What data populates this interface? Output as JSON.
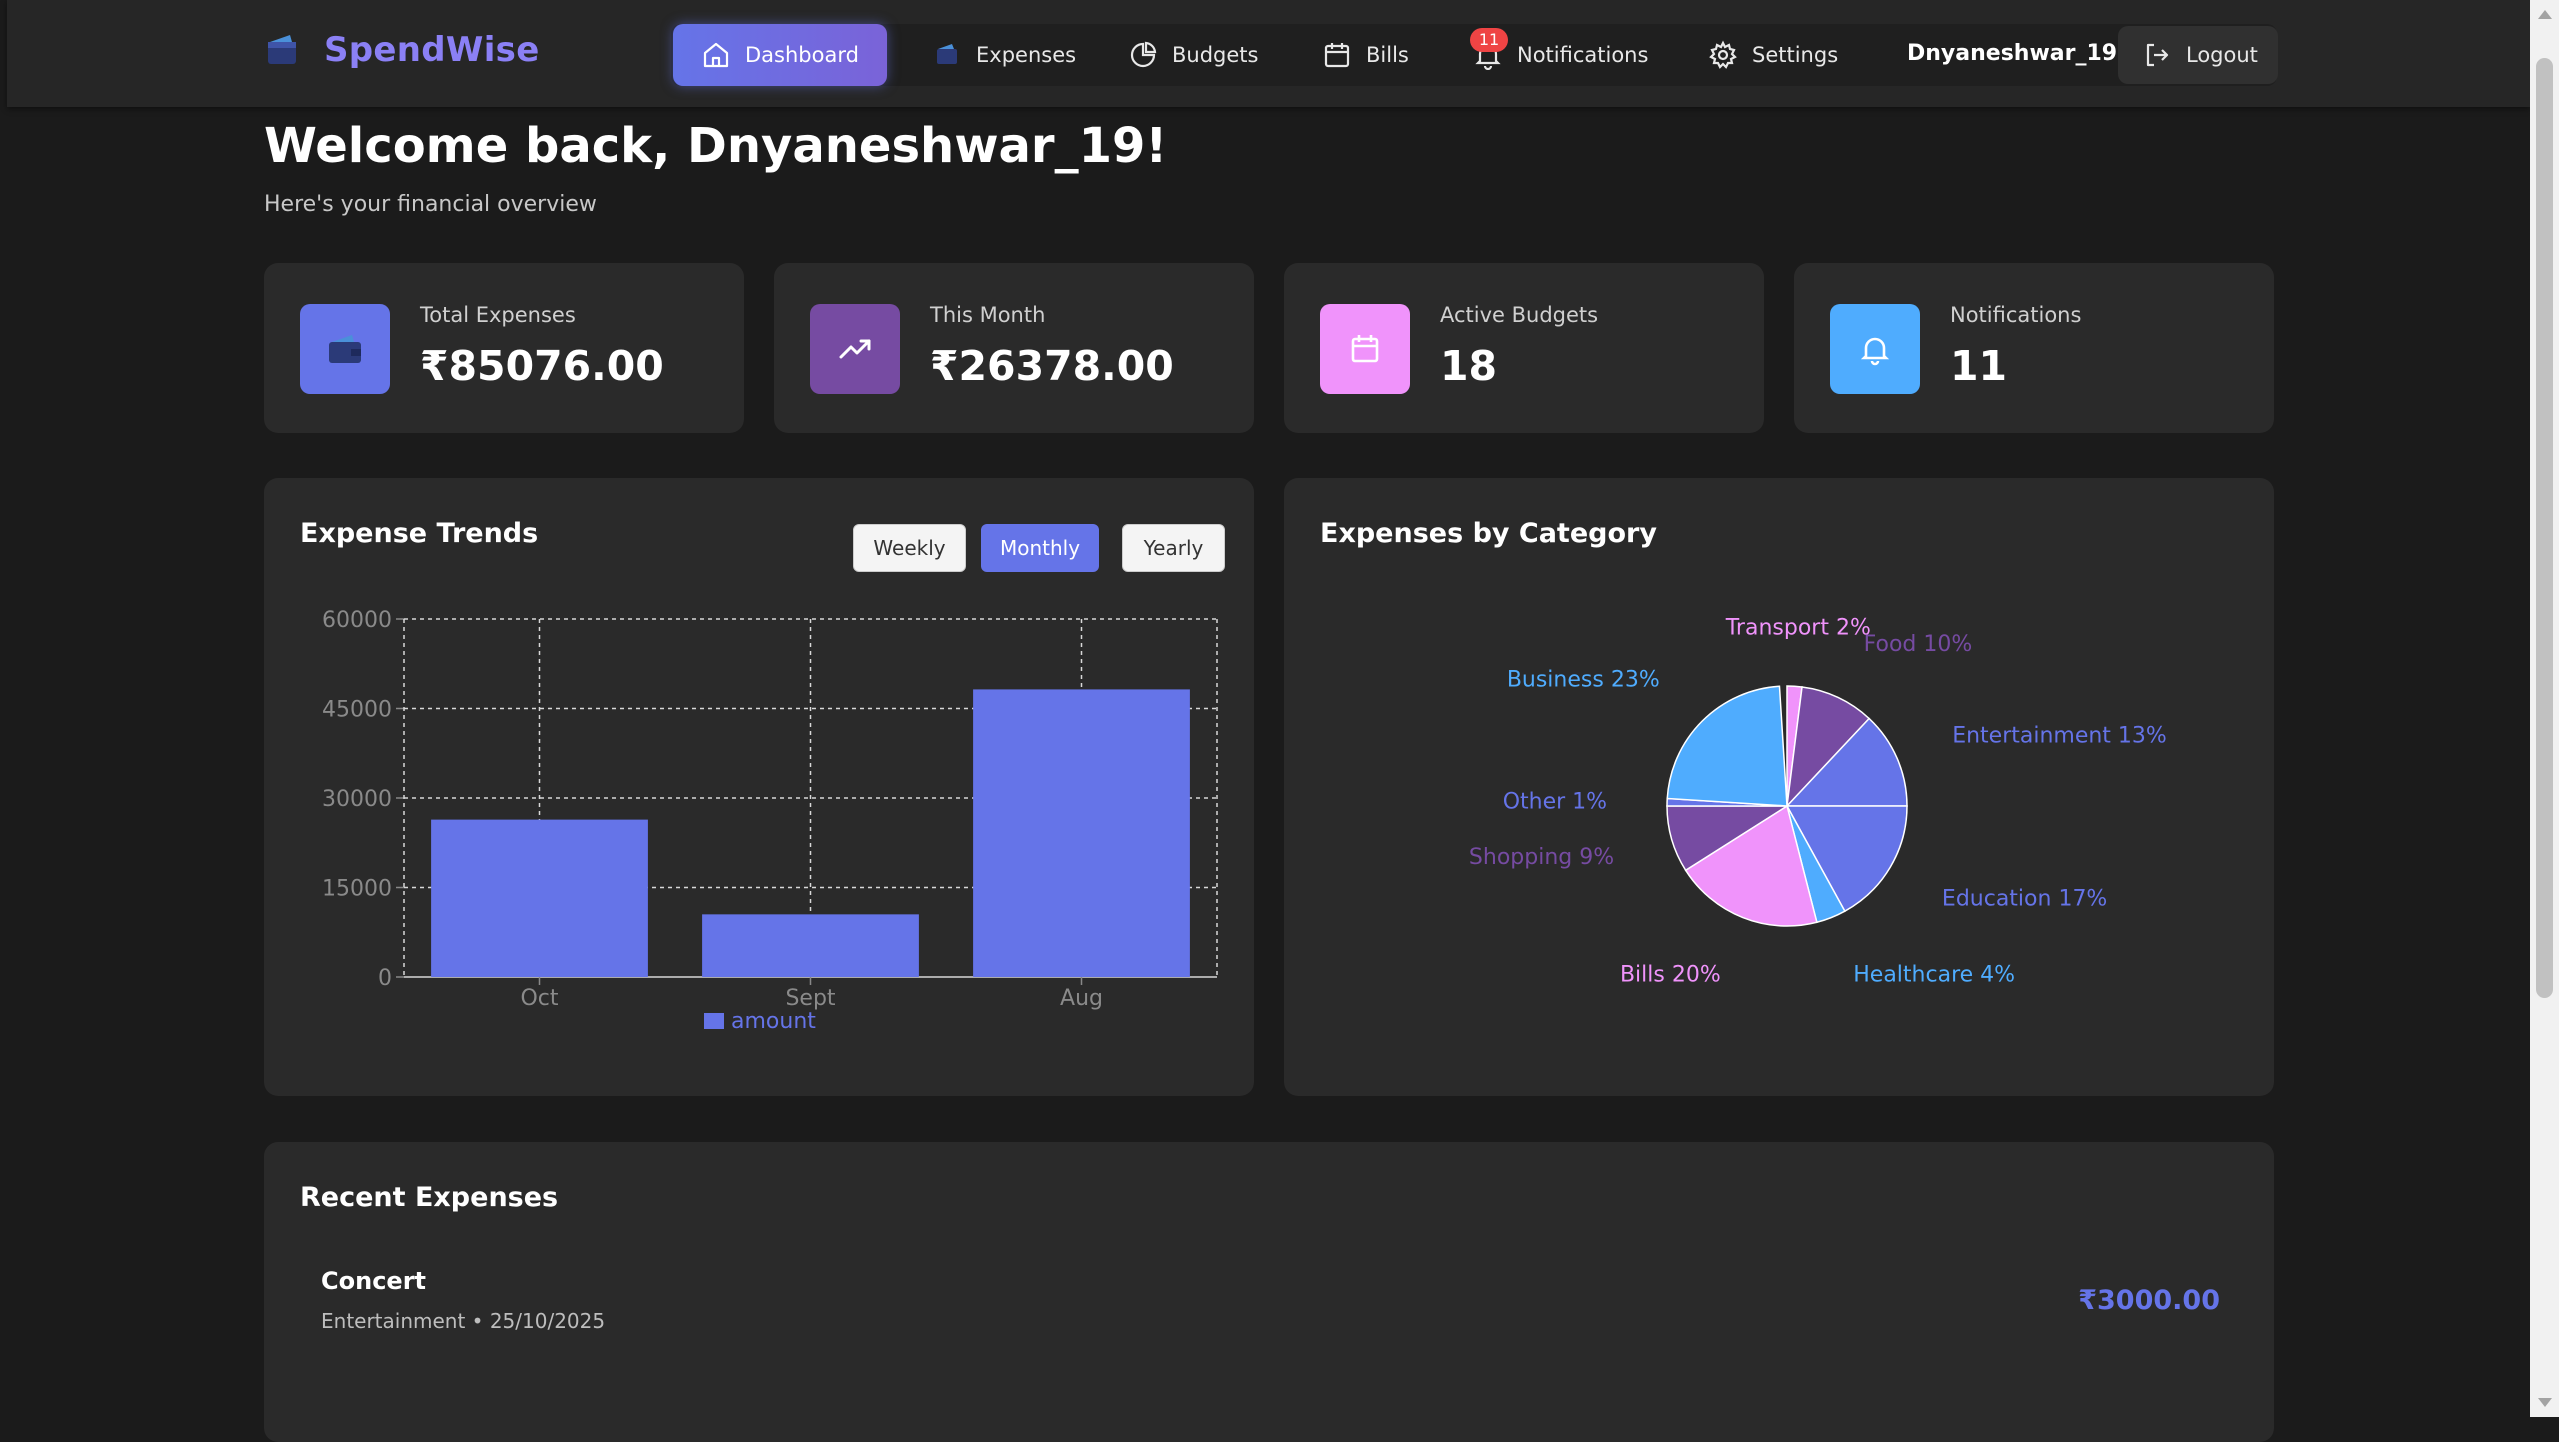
{
  "brand": {
    "name": "SpendWise"
  },
  "nav": {
    "items": [
      {
        "label": "Dashboard",
        "icon": "home-icon",
        "active": true
      },
      {
        "label": "Expenses",
        "icon": "wallet-icon"
      },
      {
        "label": "Budgets",
        "icon": "pie-chart-icon"
      },
      {
        "label": "Bills",
        "icon": "calendar-icon"
      },
      {
        "label": "Notifications",
        "icon": "bell-icon",
        "badge": "11"
      },
      {
        "label": "Settings",
        "icon": "gear-icon"
      }
    ],
    "username": "Dnyaneshwar_19",
    "logout_label": "Logout"
  },
  "header": {
    "welcome": "Welcome back, Dnyaneshwar_19!",
    "subtitle": "Here's your financial overview"
  },
  "stats": [
    {
      "label": "Total Expenses",
      "value": "₹85076.00",
      "icon": "wallet-icon",
      "color": "#6574e8"
    },
    {
      "label": "This Month",
      "value": "₹26378.00",
      "icon": "trending-up-icon",
      "color": "#764ba2"
    },
    {
      "label": "Active Budgets",
      "value": "18",
      "icon": "calendar-icon",
      "color": "#f093fb"
    },
    {
      "label": "Notifications",
      "value": "11",
      "icon": "bell-icon",
      "color": "#4facfe"
    }
  ],
  "trends": {
    "title": "Expense Trends",
    "periods": [
      "Weekly",
      "Monthly",
      "Yearly"
    ],
    "active_period": "Monthly"
  },
  "category": {
    "title": "Expenses by Category"
  },
  "recent": {
    "title": "Recent Expenses",
    "items": [
      {
        "title": "Concert",
        "meta": "Entertainment • 25/10/2025",
        "amount": "₹3000.00"
      }
    ]
  },
  "chart_data": [
    {
      "type": "bar",
      "categories": [
        "Oct",
        "Sept",
        "Aug"
      ],
      "series": [
        {
          "name": "amount",
          "values": [
            26378,
            10500,
            48200
          ],
          "color": "#6574e8"
        }
      ],
      "ylim": [
        0,
        60000
      ],
      "yticks": [
        0,
        15000,
        30000,
        45000,
        60000
      ],
      "grid": true,
      "legend": "bottom"
    },
    {
      "type": "pie",
      "slices": [
        {
          "label": "Transport",
          "percent": 2,
          "color": "#f093fb"
        },
        {
          "label": "Food",
          "percent": 10,
          "color": "#764ba2"
        },
        {
          "label": "Entertainment",
          "percent": 13,
          "color": "#6574e8"
        },
        {
          "label": "Education",
          "percent": 17,
          "color": "#6574e8"
        },
        {
          "label": "Healthcare",
          "percent": 4,
          "color": "#4facfe"
        },
        {
          "label": "Bills",
          "percent": 20,
          "color": "#f093fb"
        },
        {
          "label": "Shopping",
          "percent": 9,
          "color": "#764ba2"
        },
        {
          "label": "Other",
          "percent": 1,
          "color": "#6574e8"
        },
        {
          "label": "Business",
          "percent": 23,
          "color": "#4facfe"
        }
      ]
    }
  ]
}
